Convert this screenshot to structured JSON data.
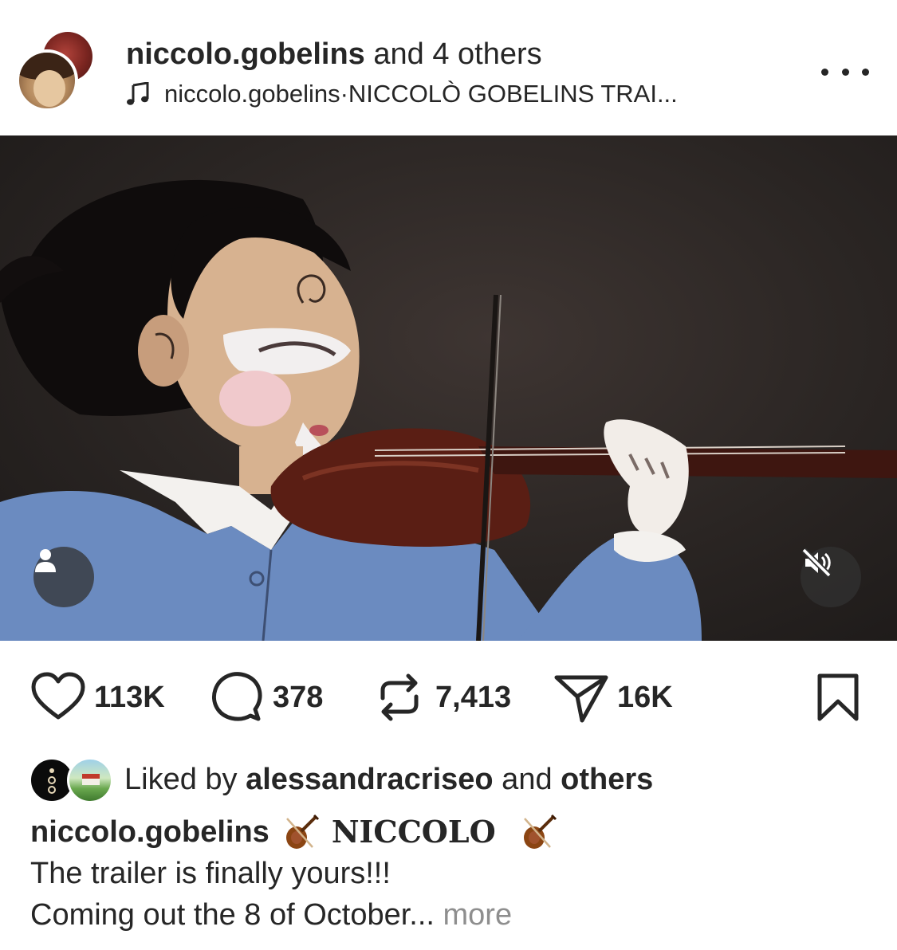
{
  "header": {
    "author": "niccolo.gobelins",
    "collab_suffix": " and 4 others",
    "audio_artist": "niccolo.gobelins",
    "audio_separator": " · ",
    "audio_title": "NICCOLÒ GOBELINS TRAI..."
  },
  "media": {
    "type": "video",
    "muted": true
  },
  "actions": {
    "likes": "113K",
    "comments": "378",
    "reposts": "7,413",
    "shares": "16K"
  },
  "likes": {
    "prefix": "Liked by ",
    "user": "alessandracriseo",
    "middle": " and ",
    "others": "others"
  },
  "caption": {
    "user": "niccolo.gobelins",
    "styled_title": "NICCOLO",
    "line2": "The trailer is finally yours!!!",
    "line3": "Coming out the 8 of October...",
    "more": " more"
  },
  "colors": {
    "text": "#262626",
    "muted": "#8e8e8e",
    "overlay": "#323232"
  }
}
